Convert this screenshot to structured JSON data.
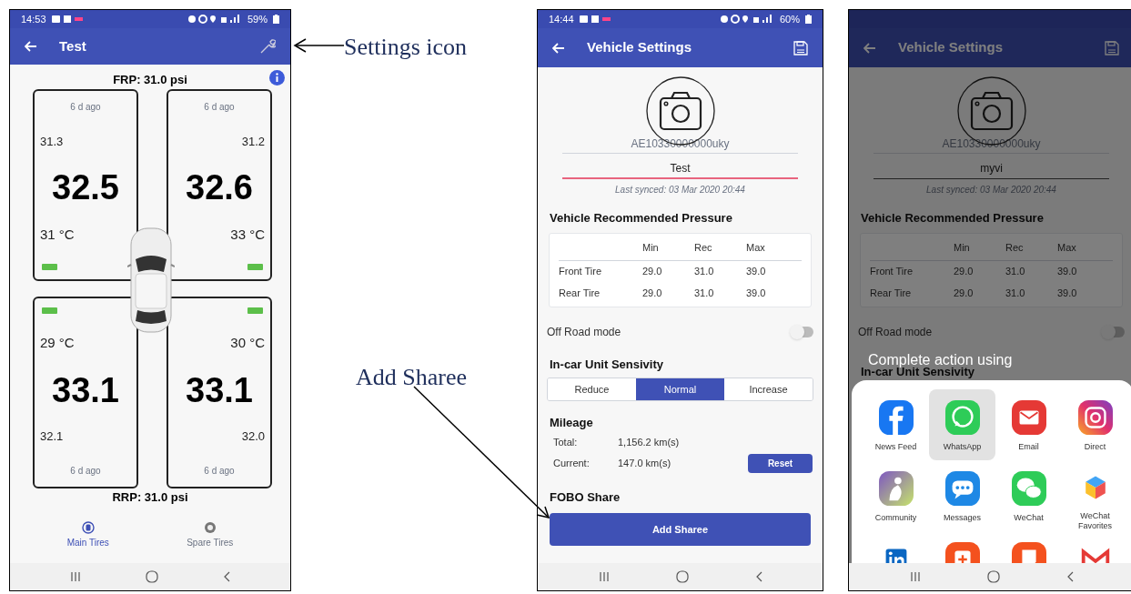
{
  "annotations": [
    {
      "kind": "settings",
      "text": "Settings icon"
    },
    {
      "kind": "share",
      "text": "Add Sharee"
    }
  ],
  "tire_screen": {
    "status_bar": {
      "time": "14:53",
      "battery": "59%"
    },
    "title": "Test",
    "front_pressure": "FRP: 31.0 psi",
    "rear_pressure": "RRP: 31.0 psi",
    "tires": [
      {
        "updated": "6 d ago",
        "reading": "31.3",
        "pressure": "32.5",
        "temperature": "31 °C"
      },
      {
        "updated": "6 d ago",
        "reading": "31.2",
        "pressure": "32.6",
        "temperature": "33 °C"
      },
      {
        "updated": "6 d ago",
        "reading": "32.1",
        "pressure": "33.1",
        "temperature": "29 °C"
      },
      {
        "updated": "6 d ago",
        "reading": "32.0",
        "pressure": "33.1",
        "temperature": "30 °C"
      }
    ],
    "tabs": [
      {
        "label": "Main Tires",
        "selected": true
      },
      {
        "label": "Spare Tires",
        "selected": false
      }
    ]
  },
  "settings_screen": {
    "status_bar": {
      "time": "14:44",
      "battery": "60%"
    },
    "title": "Vehicle Settings",
    "serial": "AE10330000000uky",
    "name": {
      "value": "Test",
      "focused": true
    },
    "last_synced": "Last synced: 03 Mar 2020 20:44",
    "section_title": "Vehicle Recommended Pressure",
    "table": {
      "columns": [
        "Min",
        "Rec",
        "Max"
      ],
      "rows": [
        {
          "label": "Front Tire",
          "values": [
            "29.0",
            "31.0",
            "39.0"
          ]
        },
        {
          "label": "Rear Tire",
          "values": [
            "29.0",
            "31.0",
            "39.0"
          ]
        }
      ]
    },
    "off_road": {
      "label": "Off Road mode",
      "on": false
    },
    "sensitivity": {
      "title": "In-car Unit Sensivity",
      "options": [
        {
          "label": "Reduce",
          "selected": false
        },
        {
          "label": "Normal",
          "selected": true
        },
        {
          "label": "Increase",
          "selected": false
        }
      ]
    },
    "mileage": {
      "title": "Mileage",
      "rows": [
        {
          "label": "Total:",
          "value": "1,156.2 km(s)"
        },
        {
          "label": "Current:",
          "value": "147.0 km(s)",
          "button": "Reset"
        }
      ]
    },
    "share": {
      "title": "FOBO Share",
      "button": "Add Sharee"
    }
  },
  "share_screen": {
    "title": "Vehicle Settings",
    "serial": "AE10330000000uky",
    "name": {
      "value": "myvi",
      "focused": false
    },
    "last_synced": "Last synced: 03 Mar 2020 20:44",
    "section_title": "Vehicle Recommended Pressure",
    "table": {
      "columns": [
        "Min",
        "Rec",
        "Max"
      ],
      "rows": [
        {
          "label": "Front Tire",
          "values": [
            "29.0",
            "31.0",
            "39.0"
          ]
        },
        {
          "label": "Rear Tire",
          "values": [
            "29.0",
            "31.0",
            "39.0"
          ]
        }
      ]
    },
    "off_road": {
      "label": "Off Road mode",
      "on": false
    },
    "sensitivity": {
      "title": "In-car Unit Sensivity"
    },
    "share_sheet": {
      "title": "Complete action using",
      "apps": [
        {
          "label": "News Feed",
          "selected": false
        },
        {
          "label": "WhatsApp",
          "selected": true
        },
        {
          "label": "Email",
          "selected": false
        },
        {
          "label": "Direct",
          "selected": false
        },
        {
          "label": "Community",
          "selected": false
        },
        {
          "label": "Messages",
          "selected": false
        },
        {
          "label": "WeChat",
          "selected": false
        },
        {
          "label": "WeChat Favorites",
          "selected": false
        },
        {
          "selected": false
        },
        {
          "selected": false
        },
        {
          "selected": false
        },
        {
          "selected": false
        }
      ]
    }
  }
}
